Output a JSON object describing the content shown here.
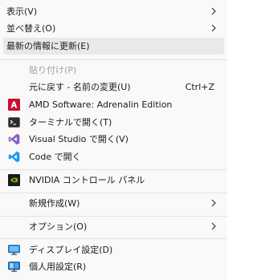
{
  "menu": {
    "items": {
      "view": {
        "label": "表示(V)"
      },
      "sort": {
        "label": "並べ替え(O)"
      },
      "refresh": {
        "label": "最新の情報に更新(E)"
      },
      "paste": {
        "label": "貼り付け(P)"
      },
      "undo": {
        "label": "元に戻す - 名前の変更(U)",
        "shortcut": "Ctrl+Z"
      },
      "amd": {
        "label": "AMD Software: Adrenalin Edition"
      },
      "terminal": {
        "label": "ターミナルで開く(T)"
      },
      "vs": {
        "label": "Visual Studio で開く(V)"
      },
      "code": {
        "label": "Code で開く"
      },
      "nvidia": {
        "label": "NVIDIA コントロール パネル"
      },
      "new": {
        "label": "新規作成(W)"
      },
      "options": {
        "label": "オプション(O)"
      },
      "display": {
        "label": "ディスプレイ設定(D)"
      },
      "personalize": {
        "label": "個人用設定(R)"
      }
    }
  },
  "colors": {
    "amd_red": "#c8102e",
    "vs_purple": "#8661c5",
    "vscode_blue": "#1f9cf0",
    "nvidia_green": "#76b900",
    "terminal_dark": "#2b2b2b",
    "display_blue": "#2c89da",
    "personalize_blue": "#1e6fc4"
  }
}
